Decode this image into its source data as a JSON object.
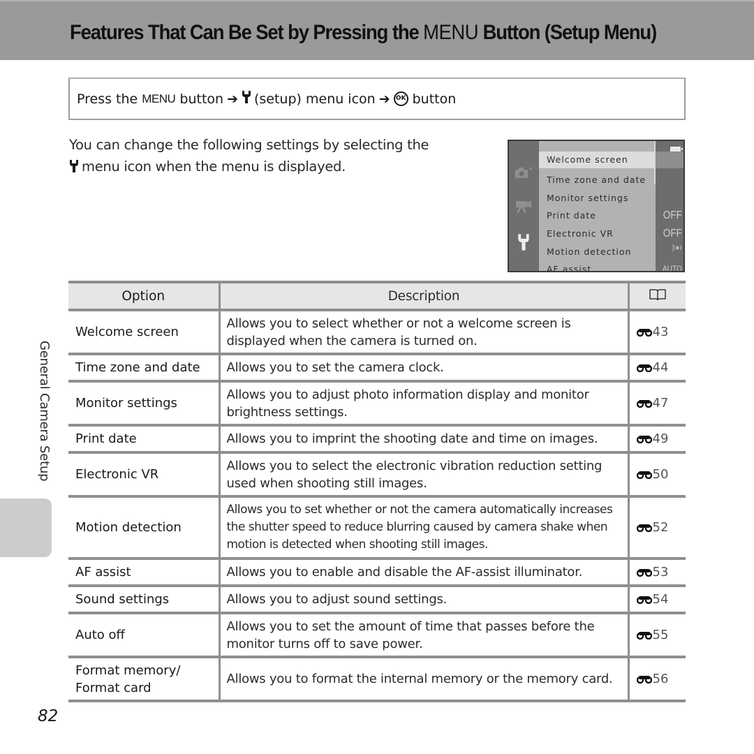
{
  "header": {
    "title_before": "Features That Can Be Set by Pressing the ",
    "title_menu": "MENU",
    "title_after": " Button (Setup Menu)"
  },
  "procedure": {
    "press_the": "Press the",
    "menu_word": "MENU",
    "button_1": "button",
    "setup_menu_icon_text": "(setup) menu icon",
    "ok_label": "OK",
    "button_2": "button"
  },
  "intro": {
    "line1": "You can change the following settings by selecting the",
    "line2": "menu icon when the menu is displayed."
  },
  "camera_screen": {
    "items": [
      {
        "label": "Welcome screen",
        "value": "",
        "selected": true
      },
      {
        "label": "Time zone and date",
        "value": ""
      },
      {
        "label": "Monitor settings",
        "value": ""
      },
      {
        "label": "Print date",
        "value": "OFF"
      },
      {
        "label": "Electronic VR",
        "value": "OFF"
      },
      {
        "label": "Motion detection",
        "value": "motion-icon"
      },
      {
        "label": "AF assist",
        "value": "AUTO"
      }
    ],
    "left_icons": [
      "camera-icon",
      "movie-icon",
      "wrench-icon"
    ]
  },
  "side": {
    "section_label": "General Camera Setup"
  },
  "table": {
    "headers": {
      "option": "Option",
      "description": "Description",
      "reference_icon": "book-icon"
    },
    "rows": [
      {
        "option": "Welcome screen",
        "description": "Allows you to select whether or not a welcome screen is displayed when the camera is turned on.",
        "ref": "43"
      },
      {
        "option": "Time zone and date",
        "description": "Allows you to set the camera clock.",
        "ref": "44"
      },
      {
        "option": "Monitor settings",
        "description": "Allows you to adjust photo information display and monitor brightness settings.",
        "ref": "47"
      },
      {
        "option": "Print date",
        "description": "Allows you to imprint the shooting date and time on images.",
        "ref": "49"
      },
      {
        "option": "Electronic VR",
        "description": "Allows you to select the electronic vibration reduction setting used when shooting still images.",
        "ref": "50"
      },
      {
        "option": "Motion detection",
        "description": "Allows you to set whether or not the camera automatically increases the shutter speed to reduce blurring caused by camera shake when motion is detected when shooting still images.",
        "ref": "52"
      },
      {
        "option": "AF assist",
        "description": "Allows you to enable and disable the AF-assist illuminator.",
        "ref": "53"
      },
      {
        "option": "Sound settings",
        "description": "Allows you to adjust sound settings.",
        "ref": "54"
      },
      {
        "option": "Auto off",
        "description": "Allows you to set the amount of time that passes before the monitor turns off to save power.",
        "ref": "55"
      },
      {
        "option": "Format memory/ Format card",
        "description": "Allows you to format the internal memory or the memory card.",
        "ref": "56"
      }
    ]
  },
  "footer": {
    "page_number": "82"
  }
}
